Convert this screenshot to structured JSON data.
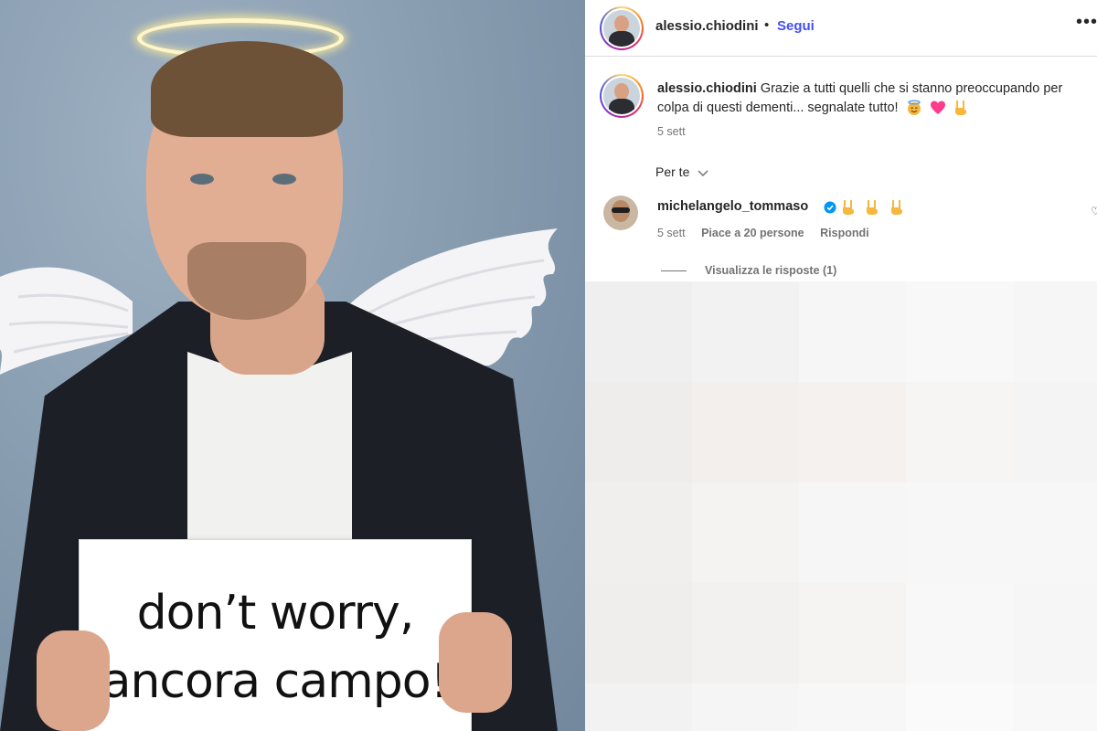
{
  "post": {
    "sign_text_line1": "don’t worry,",
    "sign_text_line2": "ancora campo!"
  },
  "header": {
    "username": "alessio.chiodini",
    "dot": "•",
    "follow_label": "Segui",
    "more_icon": "more-horizontal-icon"
  },
  "caption": {
    "username": "alessio.chiodini",
    "text": "Grazie a tutti quelli che si stanno preoccupando per colpa di questi dementi... segnalate tutto!",
    "emojis": [
      "smiling-face-with-halo-icon",
      "pink-heart-icon",
      "sign-of-the-horns-icon"
    ],
    "time": "5 sett"
  },
  "comments_filter": {
    "label": "Per te"
  },
  "comment": {
    "username": "michelangelo_tommaso",
    "verified": true,
    "emojis": [
      "sign-of-the-horns-icon",
      "sign-of-the-horns-icon",
      "sign-of-the-horns-icon"
    ],
    "time": "5 sett",
    "likes": "Piace a 20 persone",
    "reply_label": "Rispondi",
    "view_replies": "Visualizza le risposte (1)"
  },
  "colors": {
    "follow_blue": "#4150f7",
    "muted_text": "#737373",
    "verified_blue": "#0095f6",
    "heart_pink": "#ff3b8d",
    "horns_yellow": "#f6b73c"
  },
  "pixelated_area_colors": [
    "#efefef",
    "#f3f2f2",
    "#f6f6f6",
    "#f8f8f8",
    "#f6f6f6",
    "#efedeb",
    "#f2efec",
    "#f5f1ee",
    "#f7f5f3",
    "#f4f4f4",
    "#f1efee",
    "#f4f3f2",
    "#f6f6f6",
    "#f8f7f7",
    "#f7f7f7",
    "#f0eeec",
    "#f3f1ef",
    "#f5f4f3",
    "#f8f8f8",
    "#f6f6f6",
    "#f2f2f2",
    "#f5f5f5",
    "#f7f7f7",
    "#fafafa",
    "#f8f8f8"
  ]
}
